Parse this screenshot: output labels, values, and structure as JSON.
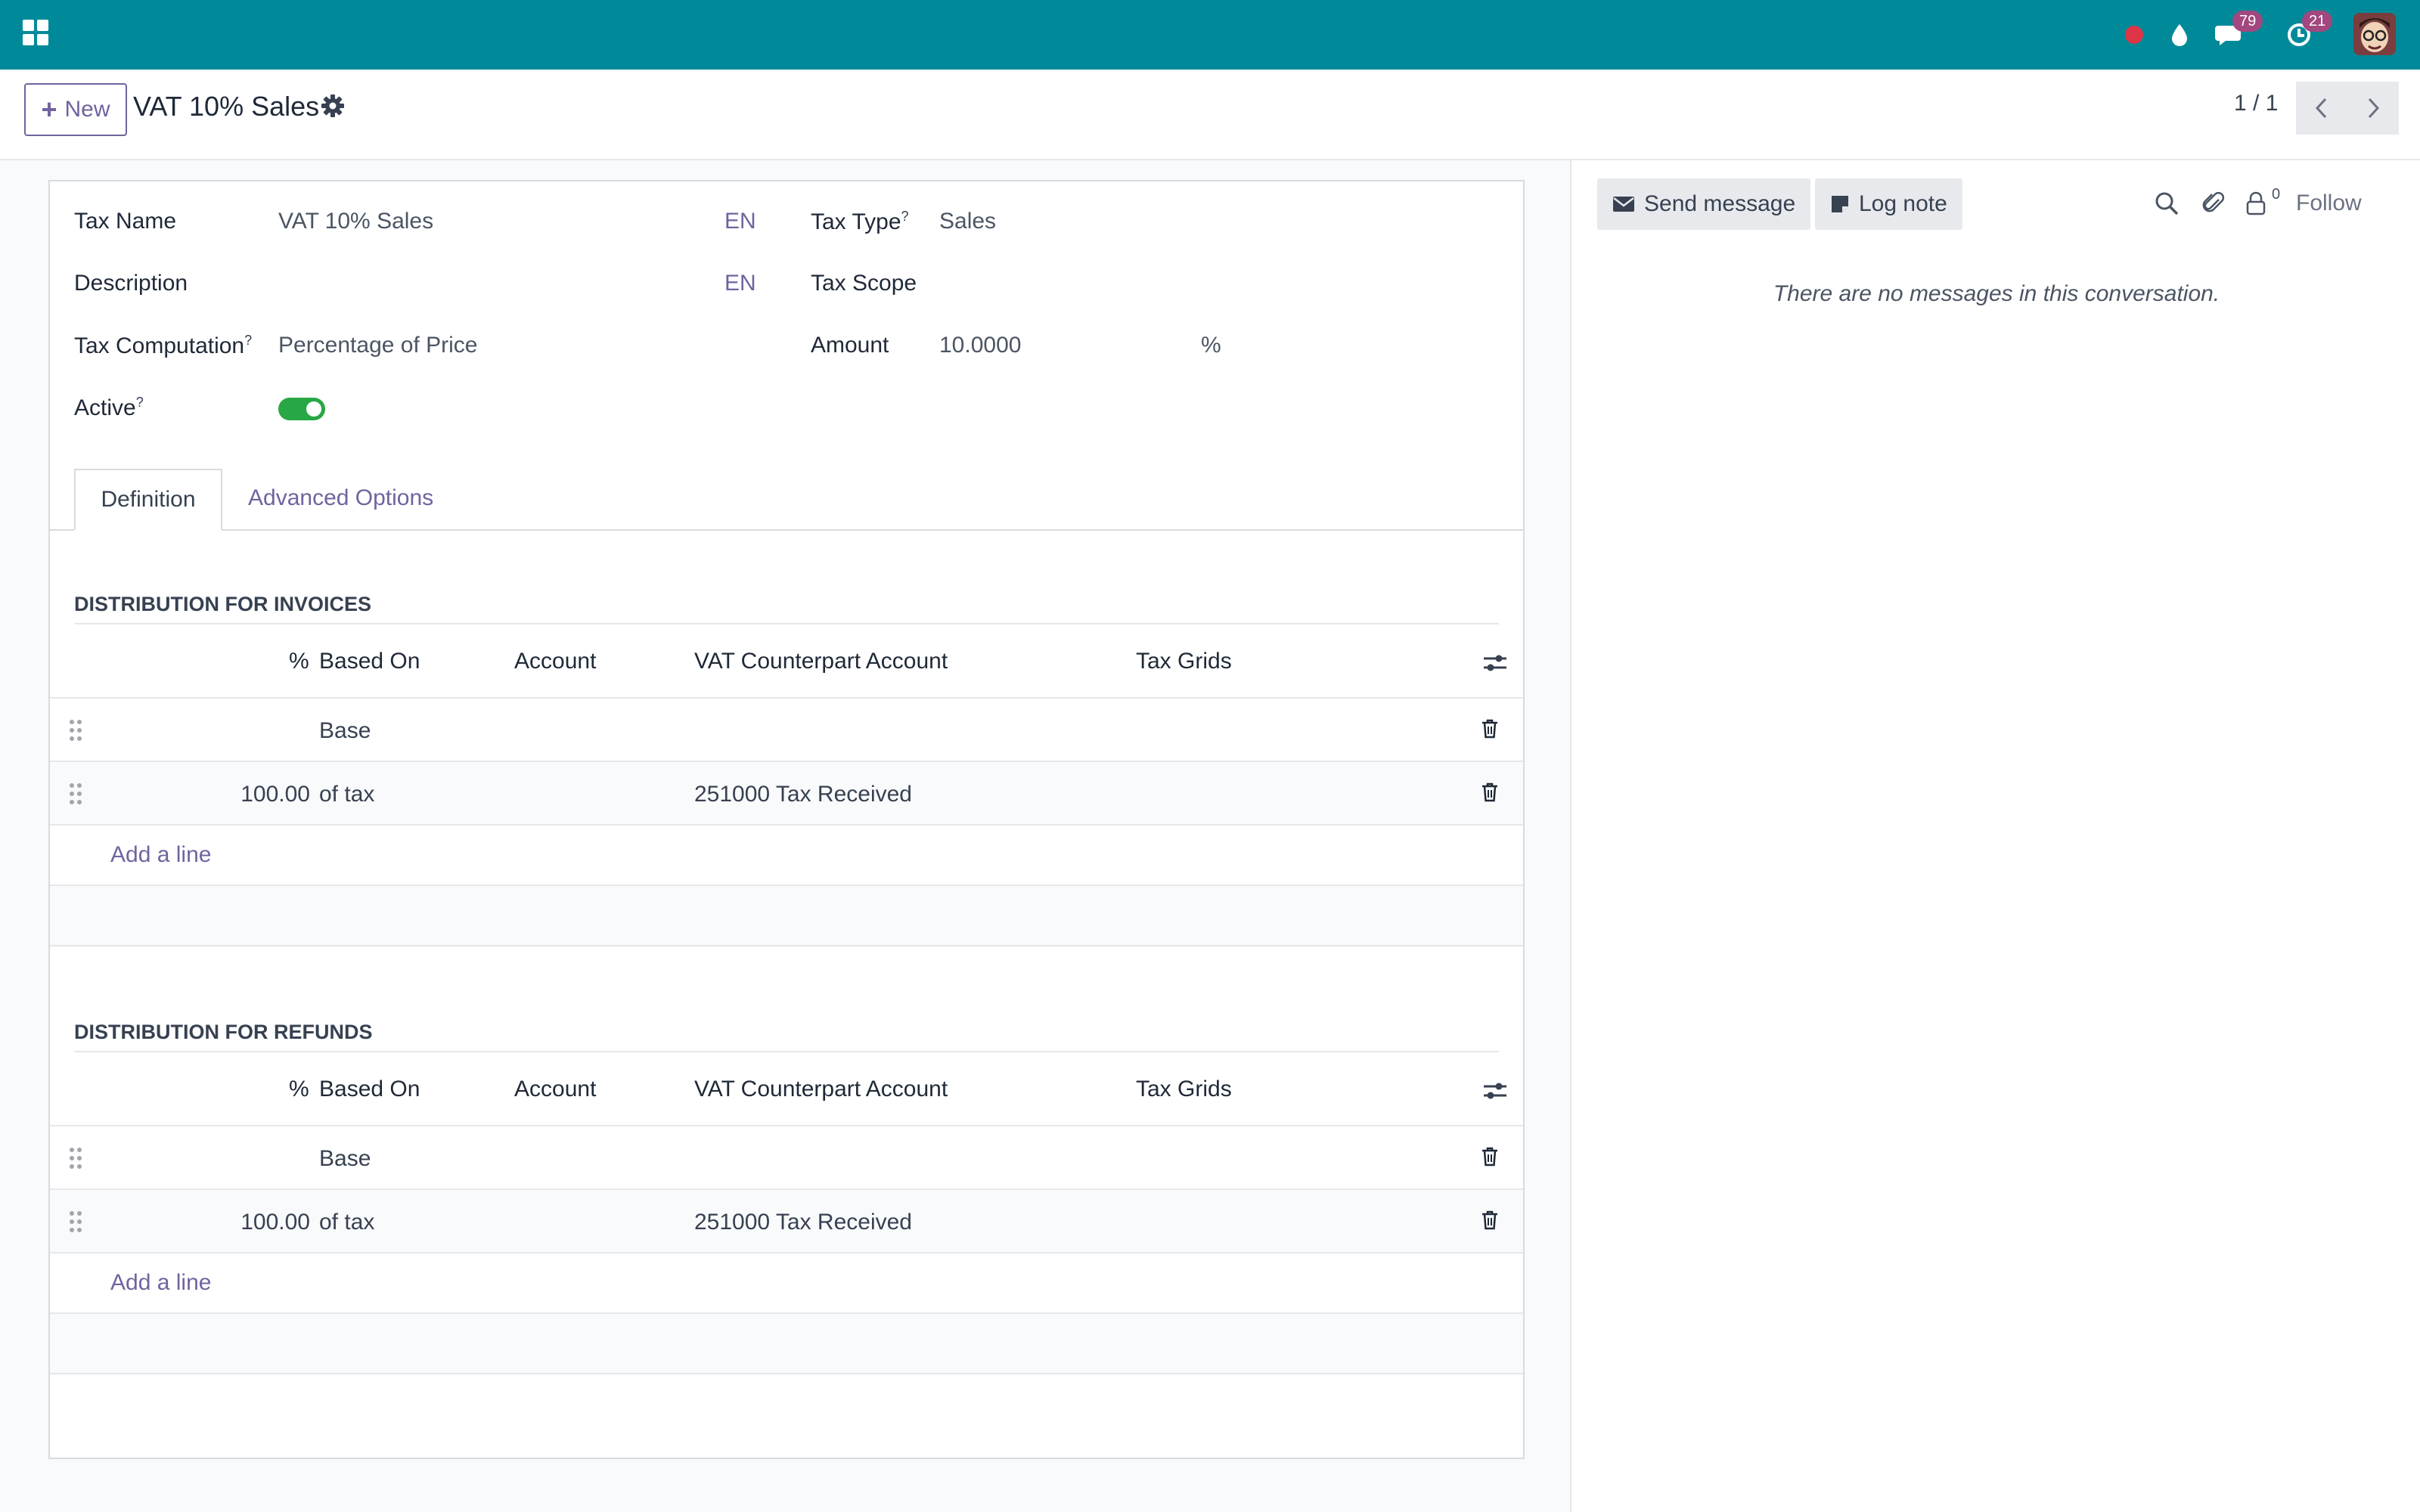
{
  "topbar": {
    "messages_count": "79",
    "activities_count": "21",
    "colors": {
      "bar": "#008a99",
      "badge": "#a2477f",
      "status_dot": "#dc3545"
    }
  },
  "control": {
    "new_label": "New",
    "record_title": "VAT 10% Sales",
    "pager": "1 / 1"
  },
  "form": {
    "tax_name_label": "Tax Name",
    "tax_name_value": "VAT 10% Sales",
    "tax_name_lang": "EN",
    "description_label": "Description",
    "description_lang": "EN",
    "tax_computation_label": "Tax Computation",
    "tax_computation_value": "Percentage of Price",
    "active_label": "Active",
    "active_value": true,
    "tax_type_label": "Tax Type",
    "tax_type_value": "Sales",
    "tax_scope_label": "Tax Scope",
    "amount_label": "Amount",
    "amount_value": "10.0000",
    "amount_unit": "%",
    "help_mark": "?"
  },
  "tabs": [
    {
      "label": "Definition",
      "active": true
    },
    {
      "label": "Advanced Options",
      "active": false
    }
  ],
  "columns": {
    "percent": "%",
    "based_on": "Based On",
    "account": "Account",
    "counterpart": "VAT Counterpart Account",
    "tax_grids": "Tax Grids"
  },
  "invoices": {
    "title": "DISTRIBUTION FOR INVOICES",
    "rows": [
      {
        "percent": "",
        "based_on": "Base",
        "account": "",
        "counterpart": "",
        "tax_grids": ""
      },
      {
        "percent": "100.00",
        "based_on": "of tax",
        "account": "",
        "counterpart": "251000 Tax Received",
        "tax_grids": ""
      }
    ],
    "add_line": "Add a line"
  },
  "refunds": {
    "title": "DISTRIBUTION FOR REFUNDS",
    "rows": [
      {
        "percent": "",
        "based_on": "Base",
        "account": "",
        "counterpart": "",
        "tax_grids": ""
      },
      {
        "percent": "100.00",
        "based_on": "of tax",
        "account": "",
        "counterpart": "251000 Tax Received",
        "tax_grids": ""
      }
    ],
    "add_line": "Add a line"
  },
  "chatter": {
    "send_message": "Send message",
    "log_note": "Log note",
    "followers_count": "0",
    "follow": "Follow",
    "empty_text": "There are no messages in this conversation."
  },
  "icons": [
    "apps-grid-icon",
    "record-dot-icon",
    "drop-icon",
    "chat-icon",
    "activity-clock-icon",
    "gear-icon",
    "chevron-left-icon",
    "chevron-right-icon",
    "drag-handle-icon",
    "trash-icon",
    "optional-columns-icon",
    "envelope-icon",
    "note-icon",
    "search-icon",
    "paperclip-icon",
    "lock-user-icon"
  ]
}
